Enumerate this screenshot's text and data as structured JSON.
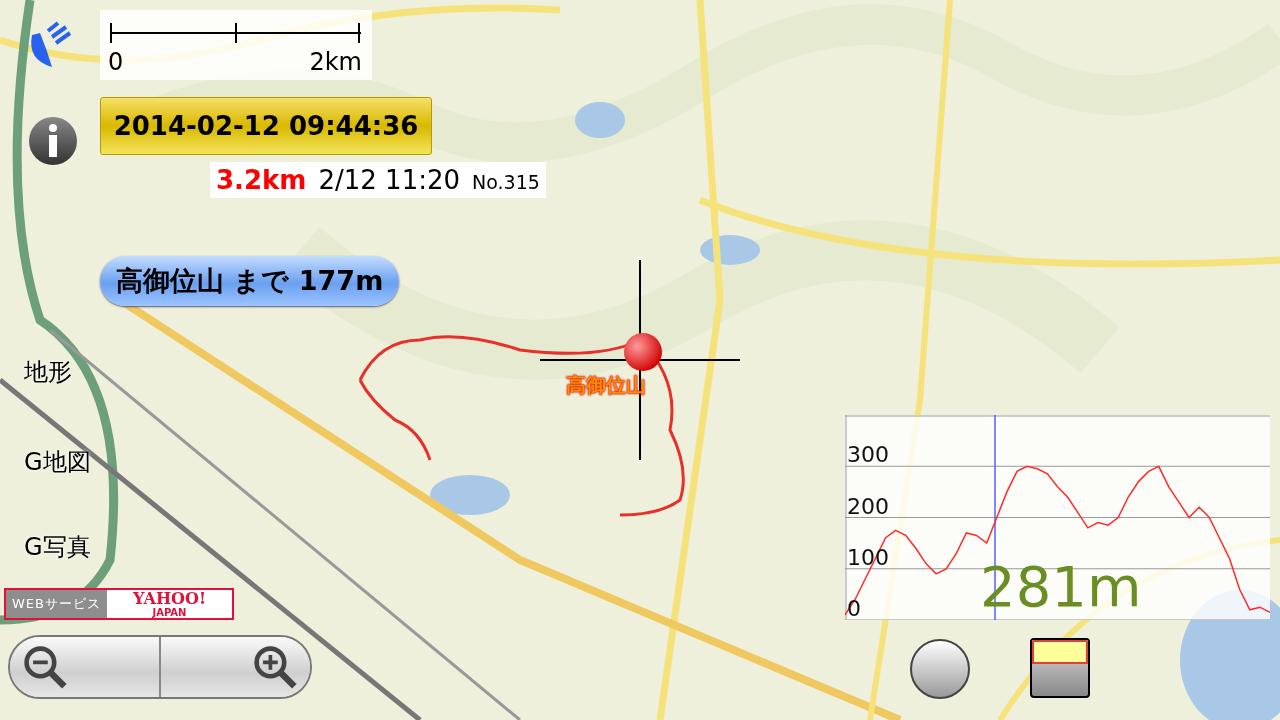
{
  "scale_bar": {
    "start": "0",
    "end": "2km"
  },
  "datetime": "2014-02-12 09:44:36",
  "track_info": {
    "distance": "3.2km",
    "time": "2/12 11:20",
    "number": "No.315"
  },
  "destination": "高御位山 まで 177m",
  "target_label": "高御位山",
  "layer_buttons": [
    {
      "label": "地形"
    },
    {
      "label": "G地図"
    },
    {
      "label": "G写真"
    }
  ],
  "credit": {
    "service": "WEBサービス",
    "brand": "YAHOO!",
    "sub": "JAPAN"
  },
  "elevation": {
    "reading": "281m",
    "chart_data": {
      "type": "line",
      "ylim": [
        0,
        400
      ],
      "yticks": [
        0,
        100,
        200,
        300
      ],
      "grid": true,
      "series": [
        {
          "color": "#ff2a2a",
          "values": [
            10,
            40,
            80,
            120,
            160,
            175,
            165,
            140,
            110,
            90,
            100,
            130,
            170,
            165,
            150,
            200,
            250,
            290,
            300,
            295,
            285,
            260,
            240,
            210,
            180,
            190,
            185,
            200,
            240,
            270,
            290,
            300,
            260,
            230,
            200,
            220,
            200,
            160,
            120,
            60,
            20,
            25,
            15
          ]
        }
      ]
    }
  }
}
